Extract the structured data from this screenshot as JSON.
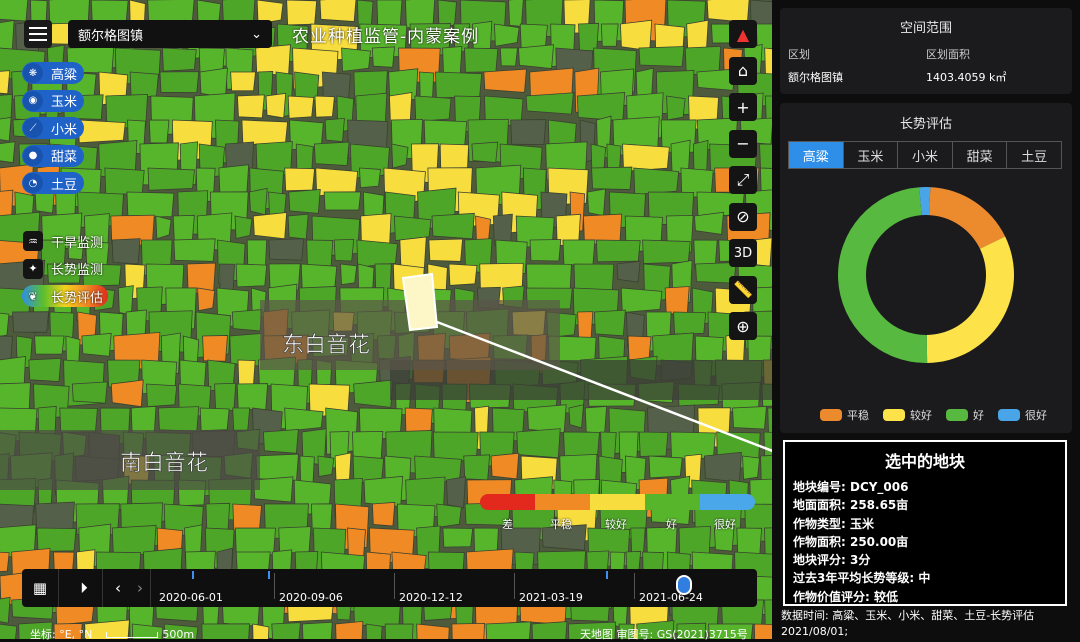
{
  "app": {
    "title": "农业种植监管-内蒙案例",
    "region_select": "额尔格图镇"
  },
  "crops": [
    {
      "label": "高粱",
      "icon": "sorghum-icon"
    },
    {
      "label": "玉米",
      "icon": "corn-icon"
    },
    {
      "label": "小米",
      "icon": "millet-icon"
    },
    {
      "label": "甜菜",
      "icon": "beet-icon"
    },
    {
      "label": "土豆",
      "icon": "potato-icon"
    }
  ],
  "tools": [
    {
      "label": "干旱监测",
      "icon": "drought-icon",
      "active": false
    },
    {
      "label": "长势监测",
      "icon": "sprout-icon",
      "active": false
    },
    {
      "label": "长势评估",
      "icon": "leaf-icon",
      "active": true
    }
  ],
  "map_labels": [
    "东白音花",
    "南白音花"
  ],
  "map_controls": {
    "three_d": "3D"
  },
  "growth_legend": {
    "labels": [
      "差",
      "平稳",
      "较好",
      "好",
      "很好"
    ],
    "colors": [
      "#e3291e",
      "#f08a24",
      "#f7dd3d",
      "#57b52c",
      "#4aa7ea"
    ]
  },
  "timeline": {
    "dates": [
      "2020-06-01",
      "2020-09-06",
      "2020-12-12",
      "2021-03-19",
      "2021-06-24"
    ]
  },
  "footer": {
    "coords": "坐标: °E, °N",
    "scale": "500m",
    "copyright": "天地图 审图号: GS(2021)3715号"
  },
  "space_panel": {
    "title": "空间范围",
    "col1_header": "区划",
    "col2_header": "区划面积",
    "col1_value": "额尔格图镇",
    "col2_value": "1403.4059 k㎡"
  },
  "growth_panel": {
    "title": "长势评估",
    "tabs": [
      "高粱",
      "玉米",
      "小米",
      "甜菜",
      "土豆"
    ],
    "active_tab": 0
  },
  "chart_data": {
    "type": "pie",
    "categories": [
      "平稳",
      "较好",
      "好",
      "很好"
    ],
    "values": [
      17,
      32,
      49,
      2
    ],
    "colors": [
      "#ec8b2e",
      "#fde24a",
      "#58b940",
      "#4aa5e8"
    ]
  },
  "selected_plot": {
    "title": "选中的地块",
    "rows": [
      "地块编号: DCY_006",
      "地面面积: 258.65亩",
      "作物类型: 玉米",
      "作物面积: 250.00亩",
      "地块评分: 3分",
      "过去3年平均长势等级: 中",
      "作物价值评分: 较低"
    ]
  },
  "data_time": "数据时间: 高粱、玉米、小米、甜菜、土豆-长势评估 2021/08/01;"
}
